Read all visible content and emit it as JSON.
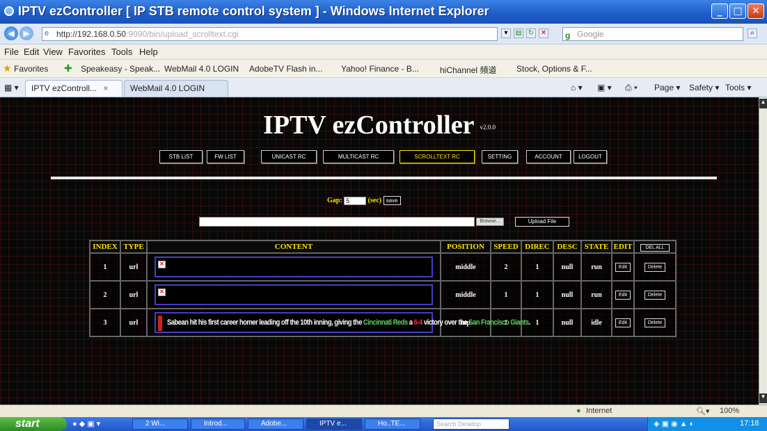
{
  "window": {
    "title": "IPTV ezController [ IP STB remote control system ] - Windows Internet Explorer",
    "minimize": "_",
    "maximize": "□",
    "close": "✕"
  },
  "address": {
    "url": "http://192.168.0.50",
    "url_rest": ":9090/bin/upload_scrolltext.cgi",
    "search_placeholder": "Google"
  },
  "menu": [
    "File",
    "Edit",
    "View",
    "Favorites",
    "Tools",
    "Help"
  ],
  "favorites": {
    "label": "Favorites",
    "items": [
      "Speakeasy - Speak...",
      "WebMail 4.0 LOGIN",
      "AdobeTV Flash in...",
      "Yahoo! Finance - B...",
      "hiChannel 頻道",
      "Stock, Options & F..."
    ]
  },
  "tabs": [
    {
      "label": "IPTV ezControll...",
      "active": true
    },
    {
      "label": "WebMail 4.0 LOGIN",
      "active": false
    }
  ],
  "tab_tools": {
    "page": "Page ▾",
    "safety": "Safety ▾",
    "tools": "Tools ▾"
  },
  "page": {
    "title": "IPTV ezController",
    "version": "v2.0.0",
    "nav": [
      {
        "label": "STB LIST",
        "active": false
      },
      {
        "label": "FW LIST",
        "active": false
      },
      {
        "label": "UNICAST RC",
        "active": false
      },
      {
        "label": "MULTICAST RC",
        "active": false
      },
      {
        "label": "SCROLLTEXT RC",
        "active": true
      },
      {
        "label": "SETTING",
        "active": false
      },
      {
        "label": "ACCOUNT",
        "active": false
      },
      {
        "label": "LOGOUT",
        "active": false
      }
    ],
    "gap_label": "Gap:",
    "gap_value": "5",
    "gap_unit": "(sec)",
    "save_label": "save",
    "browse_label": "Browse...",
    "upload_label": "Upload File",
    "table": {
      "headers": [
        "INDEX",
        "TYPE",
        "CONTENT",
        "POSITION",
        "SPEED",
        "DIREC",
        "DESC",
        "STATE",
        "EDIT"
      ],
      "del_all": "DEL ALL",
      "rows": [
        {
          "index": "1",
          "type": "url",
          "position": "middle",
          "speed": "2",
          "direc": "1",
          "desc": "null",
          "state": "run",
          "edit": "Edit",
          "delete": "Delete"
        },
        {
          "index": "2",
          "type": "url",
          "position": "middle",
          "speed": "1",
          "direc": "1",
          "desc": "null",
          "state": "run",
          "edit": "Edit",
          "delete": "Delete"
        },
        {
          "index": "3",
          "type": "url",
          "position": "top",
          "speed": "1",
          "direc": "1",
          "desc": "null",
          "state": "idle",
          "edit": "Edit",
          "delete": "Delete"
        }
      ],
      "row3_text": {
        "a": "Sabean hit his first career homer leading off the 10th inning, giving the ",
        "b": "Cincinnati Reds",
        "c": " a ",
        "d": "6-4",
        "e": " victory over the ",
        "f": "San Francisco Giants",
        "g": "."
      }
    }
  },
  "status": {
    "zone": "Internet",
    "zoom": "100%"
  },
  "taskbar": {
    "start": "start",
    "items": [
      "2 Wi...",
      "Introd...",
      "Adobe...",
      "IPTV e...",
      "Ho..TE..."
    ],
    "search": "Search Desktop",
    "clock": "17:18"
  }
}
